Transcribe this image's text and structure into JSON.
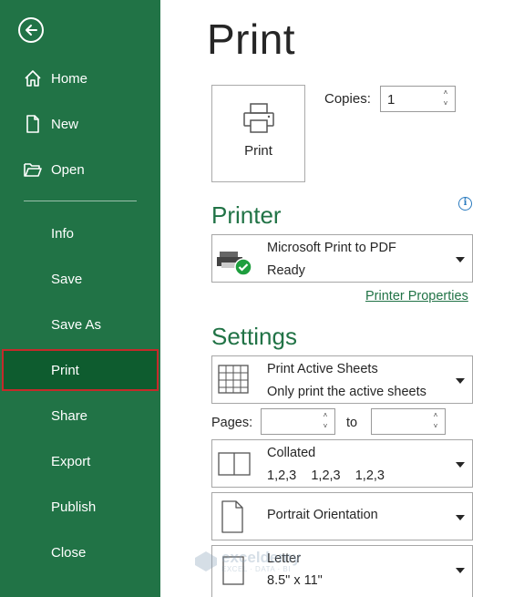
{
  "sidebar": {
    "back_icon": "back-arrow-icon",
    "items": [
      {
        "label": "Home",
        "icon": "home-icon"
      },
      {
        "label": "New",
        "icon": "new-document-icon"
      },
      {
        "label": "Open",
        "icon": "folder-open-icon"
      }
    ],
    "text_items": [
      "Info",
      "Save",
      "Save As",
      "Print",
      "Share",
      "Export",
      "Publish",
      "Close"
    ],
    "active": "Print",
    "colors": {
      "background": "#217346",
      "active_background": "#0e5c2f",
      "active_outline": "#c42a2a"
    }
  },
  "main": {
    "title": "Print",
    "print_button_label": "Print",
    "copies": {
      "label": "Copies:",
      "value": "1"
    },
    "printer": {
      "heading": "Printer",
      "name": "Microsoft Print to PDF",
      "status": "Ready",
      "properties_link": "Printer Properties"
    },
    "settings": {
      "heading": "Settings",
      "sheets": {
        "title": "Print Active Sheets",
        "subtitle": "Only print the active sheets"
      },
      "pages": {
        "label": "Pages:",
        "to_label": "to",
        "from_value": "",
        "to_value": ""
      },
      "collation": {
        "title": "Collated",
        "subtitle": "1,2,3    1,2,3    1,2,3"
      },
      "orientation": {
        "title": "Portrait Orientation"
      },
      "paper": {
        "title": "Letter",
        "subtitle": "8.5\" x 11\""
      }
    }
  },
  "watermark": {
    "line1": "exceldemy",
    "line2": "EXCEL · DATA · BI"
  },
  "accent": "#217346"
}
